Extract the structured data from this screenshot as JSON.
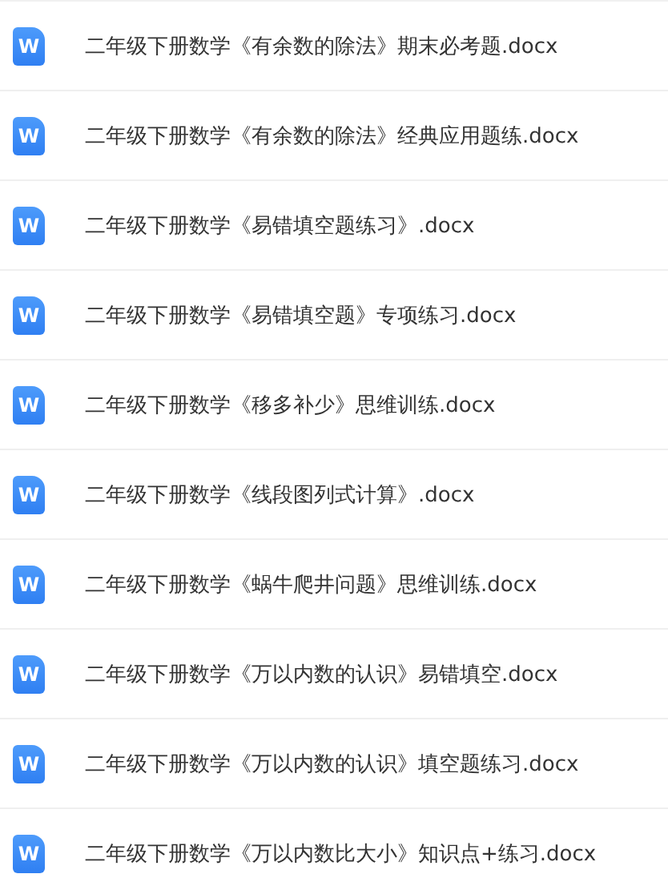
{
  "files": [
    {
      "icon": "W",
      "name": "二年级下册数学《有余数的除法》期末必考题.docx"
    },
    {
      "icon": "W",
      "name": "二年级下册数学《有余数的除法》经典应用题练.docx"
    },
    {
      "icon": "W",
      "name": "二年级下册数学《易错填空题练习》.docx"
    },
    {
      "icon": "W",
      "name": "二年级下册数学《易错填空题》专项练习.docx"
    },
    {
      "icon": "W",
      "name": "二年级下册数学《移多补少》思维训练.docx"
    },
    {
      "icon": "W",
      "name": "二年级下册数学《线段图列式计算》.docx"
    },
    {
      "icon": "W",
      "name": "二年级下册数学《蜗牛爬井问题》思维训练.docx"
    },
    {
      "icon": "W",
      "name": "二年级下册数学《万以内数的认识》易错填空.docx"
    },
    {
      "icon": "W",
      "name": "二年级下册数学《万以内数的认识》填空题练习.docx"
    },
    {
      "icon": "W",
      "name": "二年级下册数学《万以内数比大小》知识点+练习.docx"
    }
  ]
}
